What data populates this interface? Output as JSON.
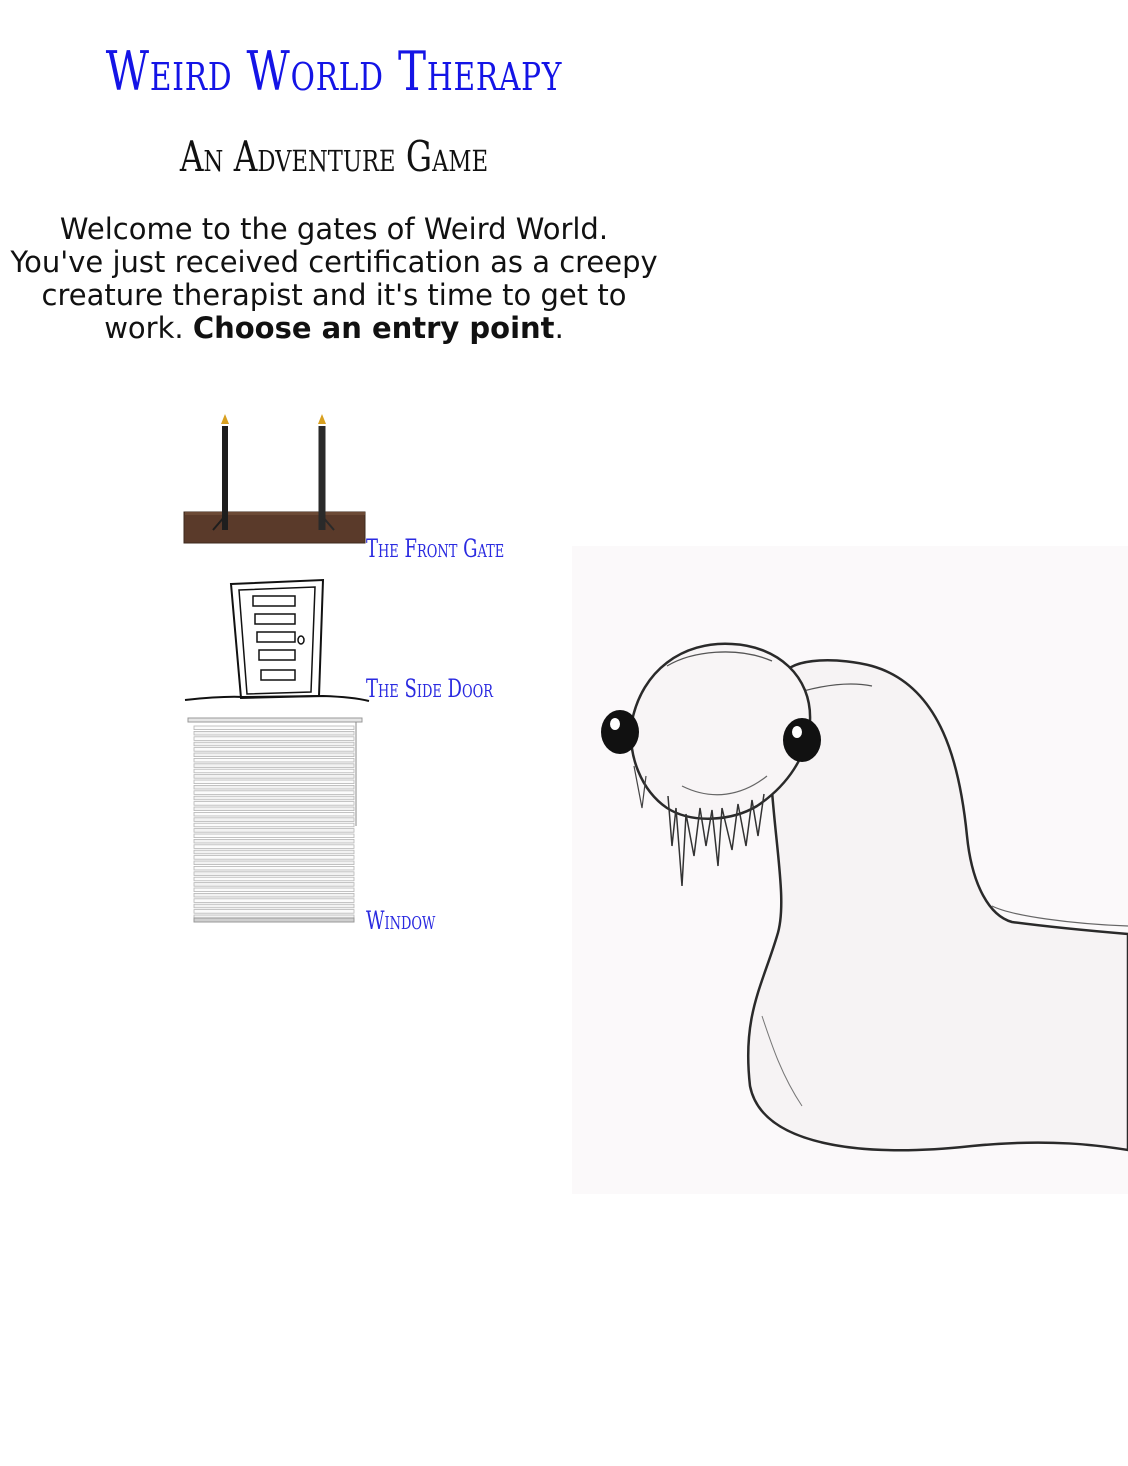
{
  "header": {
    "title": "Weird World Therapy",
    "subtitle": "An Adventure Game"
  },
  "intro": {
    "text": "Welcome to the gates of Weird World. You've just received certification as a creepy creature therapist and it's time to get to work.",
    "emphasis": "Choose an entry point",
    "trailing": "."
  },
  "entry_points": [
    {
      "label": "The Front Gate",
      "icon": "front-gate-icon"
    },
    {
      "label": "The Side Door",
      "icon": "side-door-icon"
    },
    {
      "label": "Window",
      "icon": "window-blinds-icon"
    }
  ],
  "colors": {
    "title": "#1414e6",
    "link": "#2a2ae0",
    "gate_base": "#5a3a2a"
  },
  "illustration": {
    "icon": "creepy-worm-creature-illustration"
  }
}
